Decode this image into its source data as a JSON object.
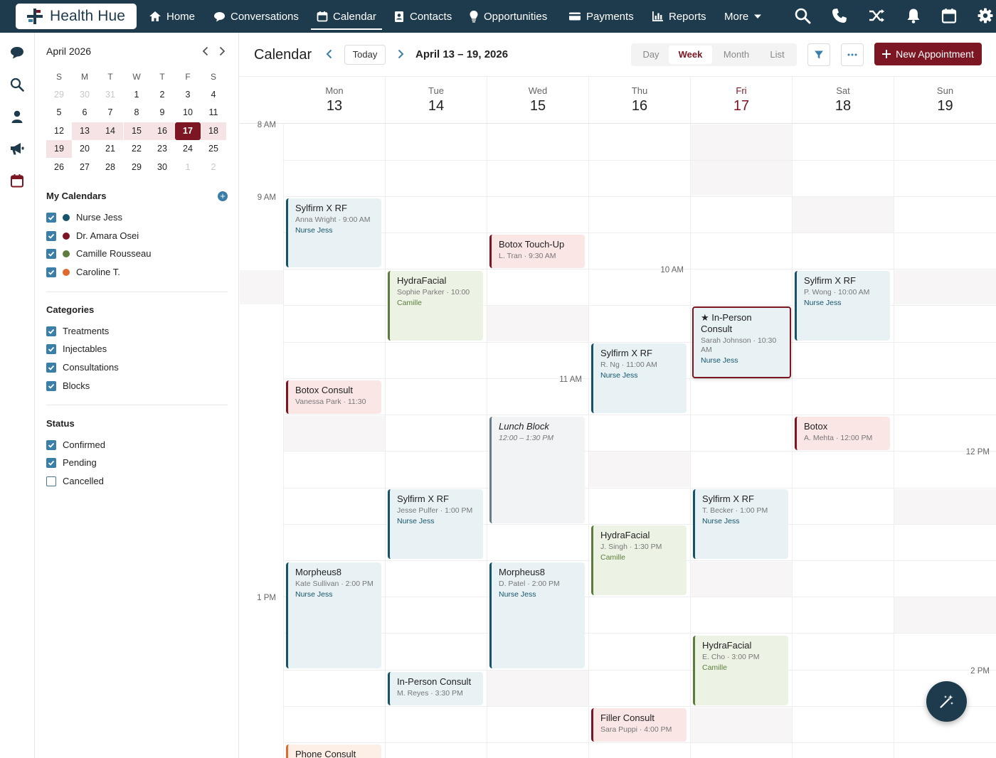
{
  "app": {
    "brand": "Health Hue"
  },
  "nav": {
    "home": "Home",
    "conversations": "Conversations",
    "calendar": "Calendar",
    "contacts": "Contacts",
    "opportunities": "Opportunities",
    "payments": "Payments",
    "reports": "Reports",
    "more": "More"
  },
  "mini_calendar": {
    "title": "April 2026",
    "weekdays": [
      "S",
      "M",
      "T",
      "W",
      "T",
      "F",
      "S"
    ],
    "rows": [
      [
        "29",
        "30",
        "31",
        "1",
        "2",
        "3",
        "4"
      ],
      [
        "5",
        "6",
        "7",
        "8",
        "9",
        "10",
        "11"
      ],
      [
        "12",
        "13",
        "14",
        "15",
        "16",
        "17",
        "18"
      ],
      [
        "19",
        "20",
        "21",
        "22",
        "23",
        "24",
        "25"
      ],
      [
        "26",
        "27",
        "28",
        "29",
        "30",
        "1",
        "2"
      ]
    ]
  },
  "sidebar": {
    "my_calendars_title": "My Calendars",
    "calendars": [
      {
        "label": "Nurse Jess",
        "color": "#15536b"
      },
      {
        "label": "Dr. Amara Osei",
        "color": "#7b1622"
      },
      {
        "label": "Camille Rousseau",
        "color": "#5d7d3c"
      },
      {
        "label": "Caroline T.",
        "color": "#e06a2e"
      }
    ],
    "categories_title": "Categories",
    "categories": [
      "Treatments",
      "Injectables",
      "Consultations",
      "Blocks"
    ],
    "status_title": "Status",
    "statuses": [
      {
        "label": "Confirmed",
        "checked": true
      },
      {
        "label": "Pending",
        "checked": true
      },
      {
        "label": "Cancelled",
        "checked": false
      }
    ]
  },
  "toolbar": {
    "title": "Calendar",
    "today": "Today",
    "range": "April 13 – 19, 2026",
    "views": [
      "Day",
      "Week",
      "Month",
      "List"
    ],
    "active_view": "Week",
    "new_appointment": "New Appointment"
  },
  "days": [
    {
      "name": "Mon",
      "num": "13"
    },
    {
      "name": "Tue",
      "num": "14"
    },
    {
      "name": "Wed",
      "num": "15"
    },
    {
      "name": "Thu",
      "num": "16"
    },
    {
      "name": "Fri",
      "num": "17"
    },
    {
      "name": "Sat",
      "num": "18"
    },
    {
      "name": "Sun",
      "num": "19"
    }
  ],
  "time_labels": [
    "8 AM",
    "9 AM",
    "10 AM",
    "11 AM",
    "12 PM",
    "1 PM",
    "2 PM"
  ],
  "events": [
    {
      "title": "Sylfirm X RF",
      "sub": "Anna Wright · 9:00 AM",
      "provider": "Nurse Jess",
      "type": "blue"
    },
    {
      "title": "Botox Touch-Up",
      "sub": "L. Tran · 9:30 AM",
      "provider": "",
      "type": "pink"
    },
    {
      "title": "HydraFacial",
      "sub": "Sophie Parker · 10:00",
      "provider": "Camille",
      "type": "green"
    },
    {
      "title": "Sylfirm X RF",
      "sub": "P. Wong · 10:00 AM",
      "provider": "Nurse Jess",
      "type": "blue"
    },
    {
      "title": "★ In-Person Consult",
      "sub": "Sarah Johnson · 10:30 AM",
      "provider": "Nurse Jess",
      "type": "star"
    },
    {
      "title": "Sylfirm X RF",
      "sub": "R. Ng · 11:00 AM",
      "provider": "Nurse Jess",
      "type": "blue"
    },
    {
      "title": "Botox Consult",
      "sub": "Vanessa Park · 11:30",
      "provider": "",
      "type": "pink"
    },
    {
      "title": "Lunch Block",
      "sub": "12:00 – 1:30 PM",
      "provider": "",
      "type": "gray"
    },
    {
      "title": "Botox",
      "sub": "A. Mehta · 12:00 PM",
      "provider": "",
      "type": "pink"
    },
    {
      "title": "Sylfirm X RF",
      "sub": "Jesse Pulfer · 1:00 PM",
      "provider": "Nurse Jess",
      "type": "blue"
    },
    {
      "title": "Sylfirm X RF",
      "sub": "T. Becker · 1:00 PM",
      "provider": "Nurse Jess",
      "type": "blue"
    },
    {
      "title": "HydraFacial",
      "sub": "J. Singh · 1:30 PM",
      "provider": "Camille",
      "type": "green"
    },
    {
      "title": "Morpheus8",
      "sub": "Kate Sullivan · 2:00 PM",
      "provider": "Nurse Jess",
      "type": "blue"
    },
    {
      "title": "Morpheus8",
      "sub": "D. Patel · 2:00 PM",
      "provider": "Nurse Jess",
      "type": "blue"
    },
    {
      "title": "HydraFacial",
      "sub": "E. Cho · 3:00 PM",
      "provider": "Camille",
      "type": "green"
    },
    {
      "title": "In-Person Consult",
      "sub": "M. Reyes · 3:30 PM",
      "provider": "",
      "type": "blue"
    },
    {
      "title": "Filler Consult",
      "sub": "Sara Puppi · 4:00 PM",
      "provider": "",
      "type": "pink"
    },
    {
      "title": "Phone Consult",
      "sub": "",
      "provider": "",
      "type": "pink"
    }
  ]
}
